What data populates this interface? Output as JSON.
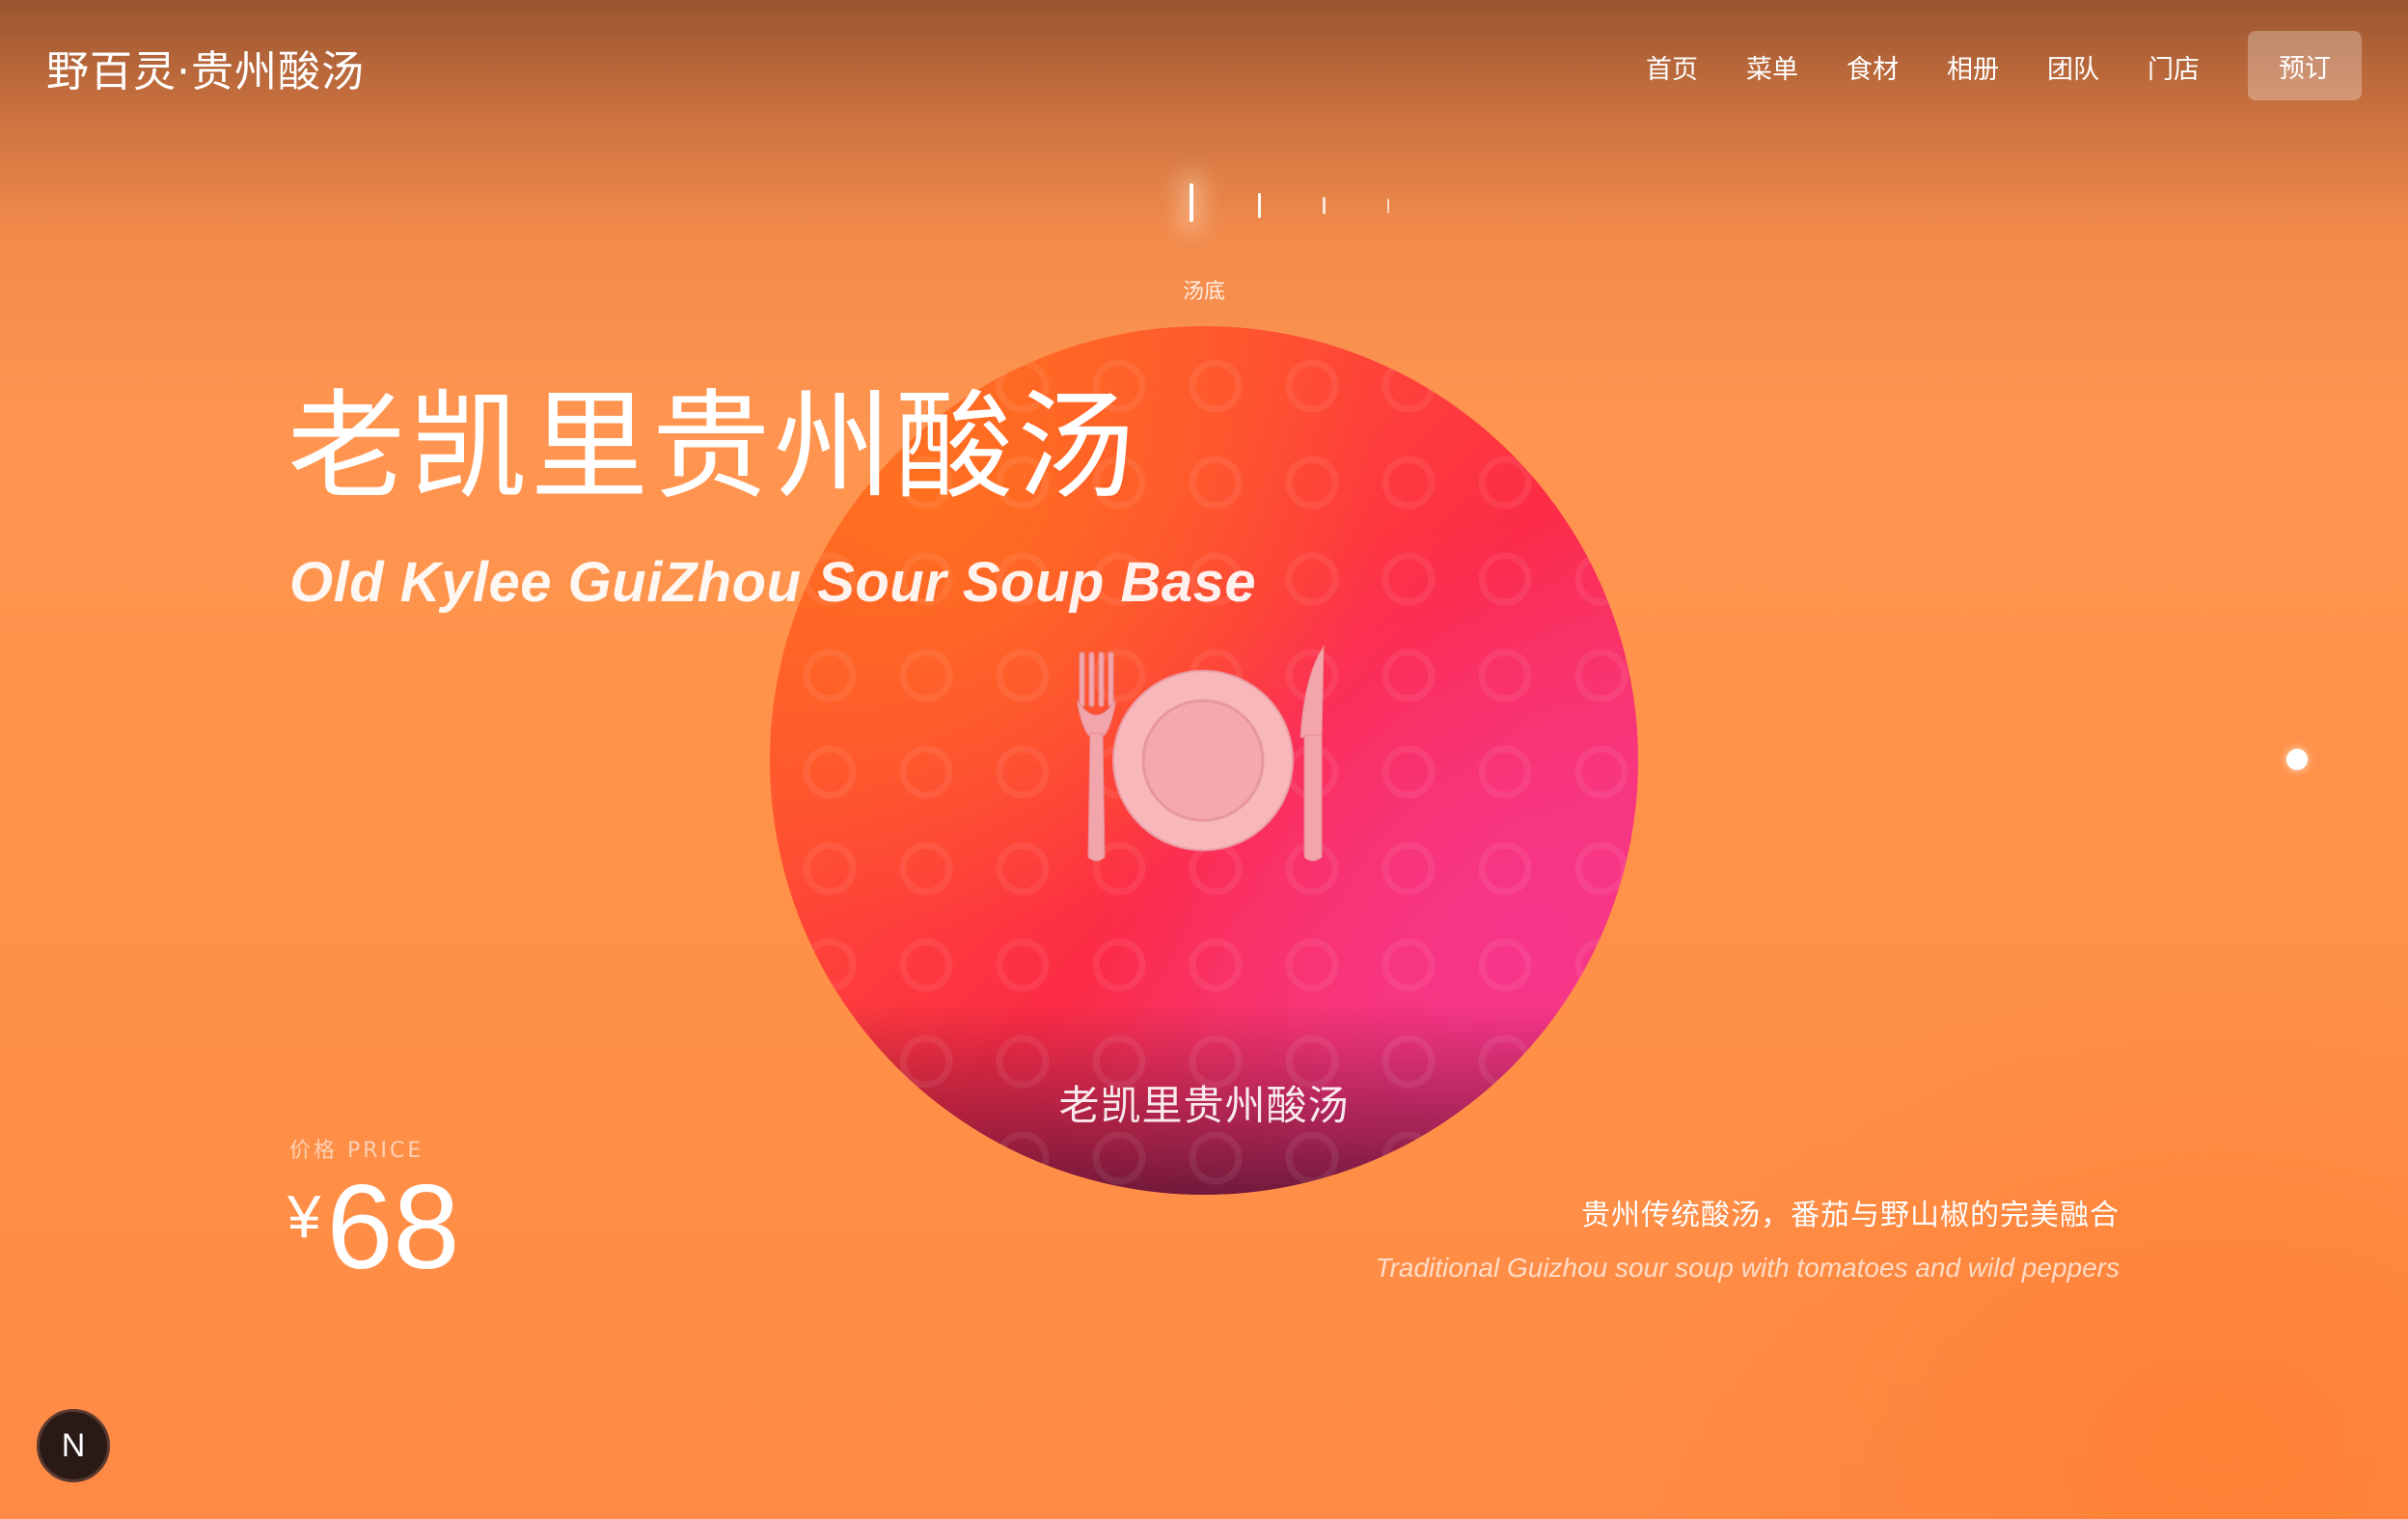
{
  "header": {
    "logo": "野百灵·贵州酸汤",
    "nav": [
      "首页",
      "菜单",
      "食材",
      "相册",
      "团队",
      "门店"
    ],
    "reserve_label": "预订"
  },
  "carousel": {
    "active_label": "汤底",
    "total_ticks": 4,
    "active_index": 0
  },
  "dish": {
    "title_cn": "老凯里贵州酸汤",
    "title_en": "Old Kylee GuiZhou Sour Soup Base",
    "image_icon": "plate-fork-knife-icon",
    "caption": "老凯里贵州酸汤",
    "price_label": "价格 PRICE",
    "currency": "¥",
    "price": "68",
    "desc_cn": "贵州传统酸汤，番茄与野山椒的完美融合",
    "desc_en": "Traditional Guizhou sour soup with tomatoes and wild peppers"
  },
  "badge": {
    "letter": "N"
  },
  "colors": {
    "background": "#ff9550",
    "circle_start": "#ff6a22",
    "circle_end": "#f43f8e"
  }
}
